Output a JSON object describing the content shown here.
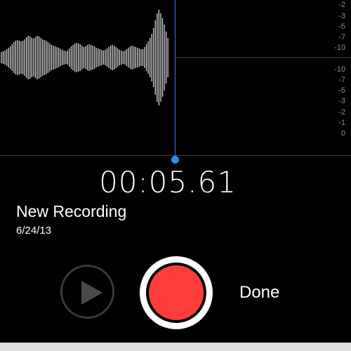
{
  "waveform": {
    "scale_labels": [
      "-2",
      "-3",
      "-5",
      "-7",
      "-10",
      "-10",
      "-7",
      "-5",
      "-3",
      "-2",
      "-1",
      "0"
    ]
  },
  "timer": "00:05.61",
  "recording": {
    "title": "New Recording",
    "date": "6/24/13"
  },
  "controls": {
    "done_label": "Done"
  },
  "colors": {
    "background": "#000000",
    "playhead": "#2f73ff",
    "record": "#fc3d39"
  }
}
